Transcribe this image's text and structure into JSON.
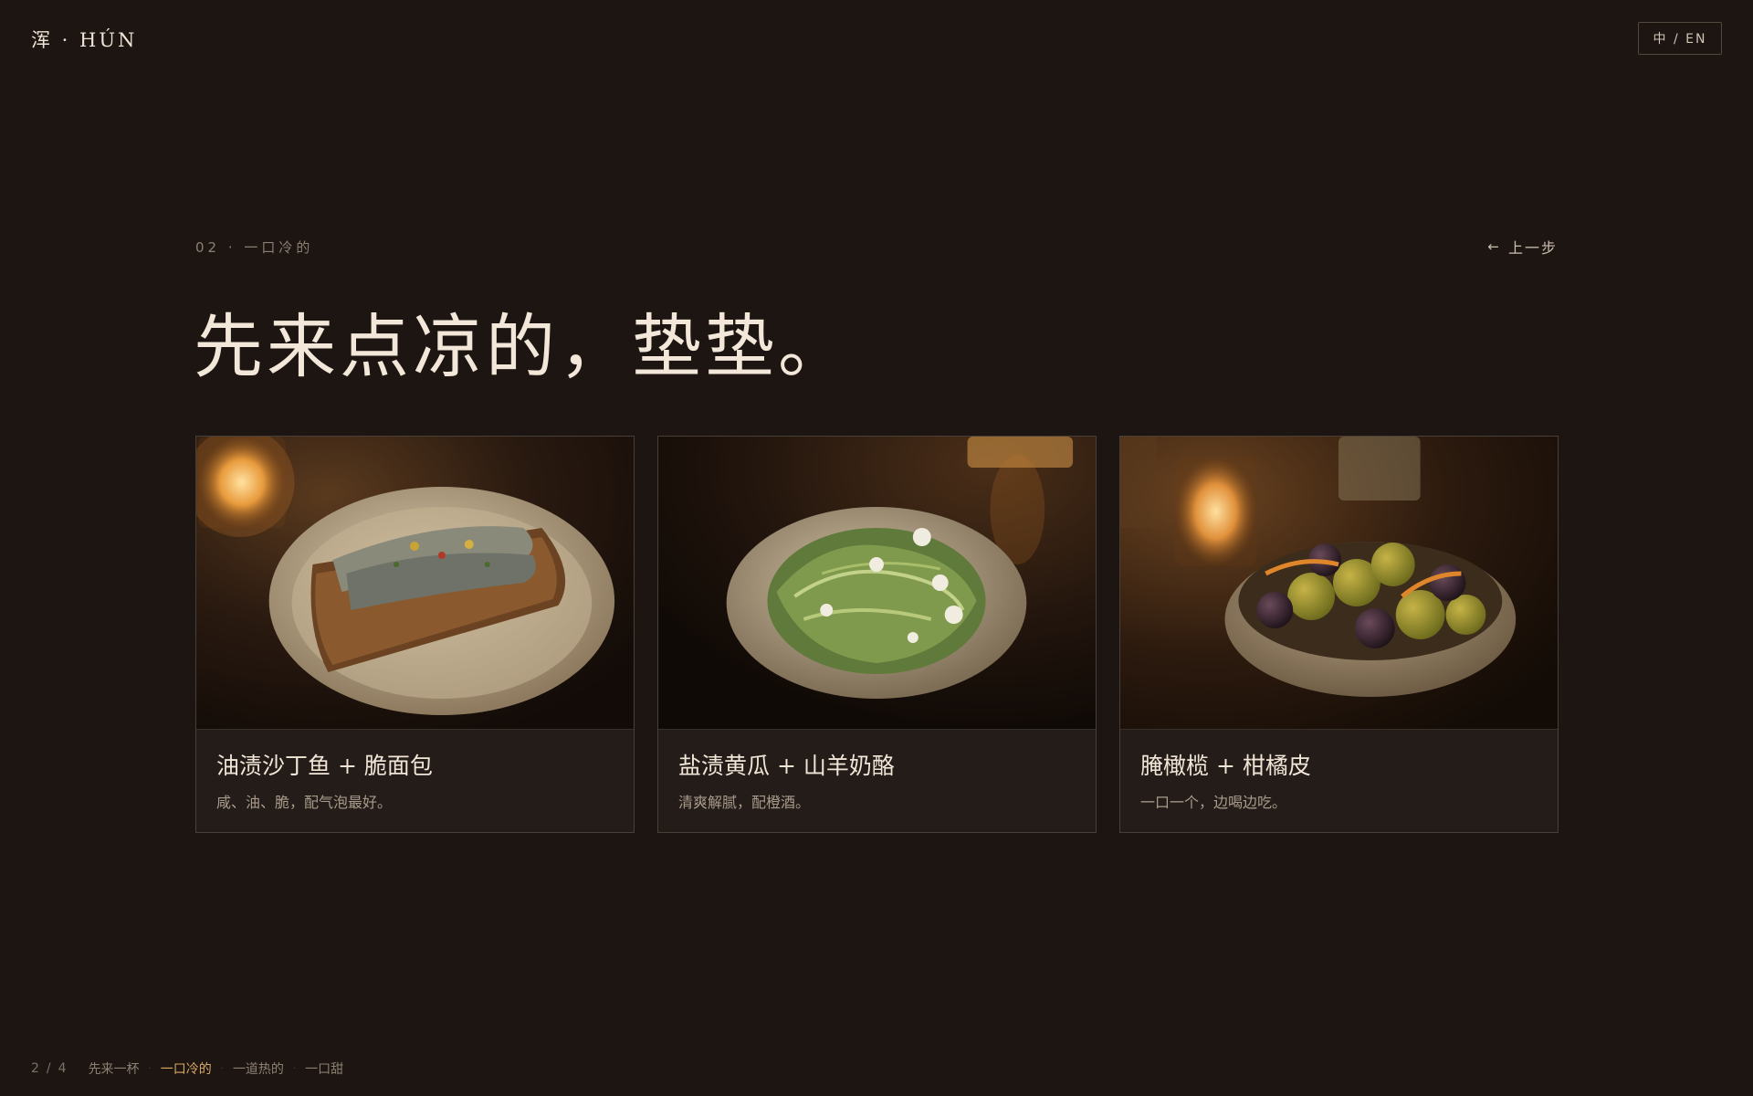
{
  "header": {
    "brand": "浑 · HÚN",
    "lang_toggle": "中 / EN"
  },
  "section": {
    "step_label": "02 · 一口冷的",
    "back_label": "上一步",
    "title": "先来点凉的，垫垫。"
  },
  "cards": [
    {
      "title": "油渍沙丁鱼 + 脆面包",
      "desc": "咸、油、脆，配气泡最好。",
      "image_icon": "sardine-toast-photo"
    },
    {
      "title": "盐渍黄瓜 + 山羊奶酪",
      "desc": "清爽解腻，配橙酒。",
      "image_icon": "cucumber-goat-cheese-photo"
    },
    {
      "title": "腌橄榄 + 柑橘皮",
      "desc": "一口一个，边喝边吃。",
      "image_icon": "marinated-olives-photo"
    }
  ],
  "progress": {
    "current": "2",
    "separator": "/",
    "total": "4",
    "items": [
      "先来一杯",
      "一口冷的",
      "一道热的",
      "一口甜"
    ],
    "active_index": 1,
    "active_color": "#d9a865"
  },
  "colors": {
    "background": "#1c1512",
    "card_background": "#231c18",
    "accent": "#d9a865"
  }
}
